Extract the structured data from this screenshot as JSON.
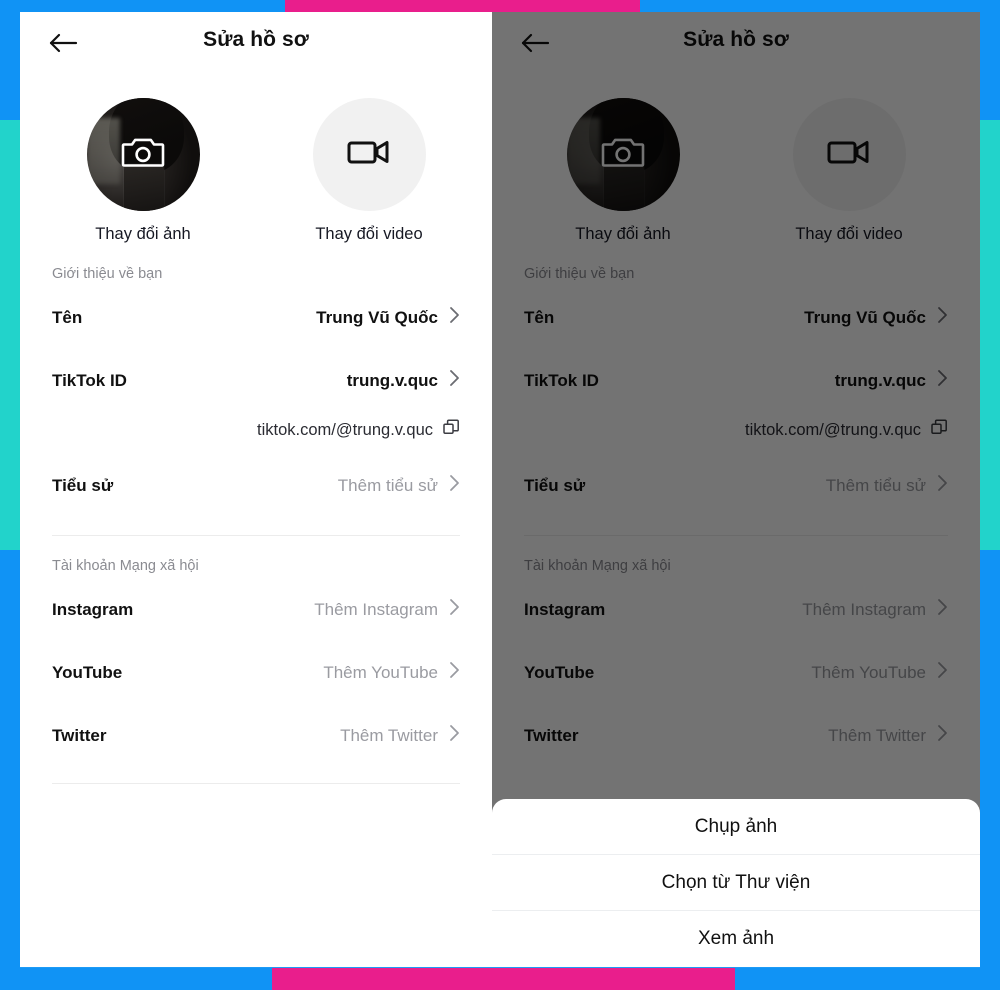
{
  "frame": {
    "blue": "#1093f5",
    "pink": "#e91e8c",
    "teal": "#22d3cb"
  },
  "header": {
    "title": "Sửa hồ sơ",
    "back_icon": "arrow-left-icon"
  },
  "media": [
    {
      "label": "Thay đổi ảnh",
      "icon": "camera-icon"
    },
    {
      "label": "Thay đổi video",
      "icon": "video-camera-icon"
    }
  ],
  "about": {
    "section_title": "Giới thiệu về bạn",
    "rows": [
      {
        "label": "Tên",
        "value": "Trung Vũ Quốc",
        "placeholder": false
      },
      {
        "label": "TikTok ID",
        "value": "trung.v.quc",
        "placeholder": false
      },
      {
        "label": "Tiểu sử",
        "value": "Thêm tiểu sử",
        "placeholder": true
      }
    ],
    "profile_url": "tiktok.com/@trung.v.quc",
    "copy_icon": "copy-icon"
  },
  "social": {
    "section_title": "Tài khoản Mạng xã hội",
    "rows": [
      {
        "label": "Instagram",
        "value": "Thêm Instagram",
        "placeholder": true
      },
      {
        "label": "YouTube",
        "value": "Thêm YouTube",
        "placeholder": true
      },
      {
        "label": "Twitter",
        "value": "Thêm Twitter",
        "placeholder": true
      }
    ]
  },
  "action_sheet": {
    "items": [
      {
        "label": "Chụp ảnh"
      },
      {
        "label": "Chọn từ Thư viện"
      },
      {
        "label": "Xem ảnh"
      }
    ]
  }
}
